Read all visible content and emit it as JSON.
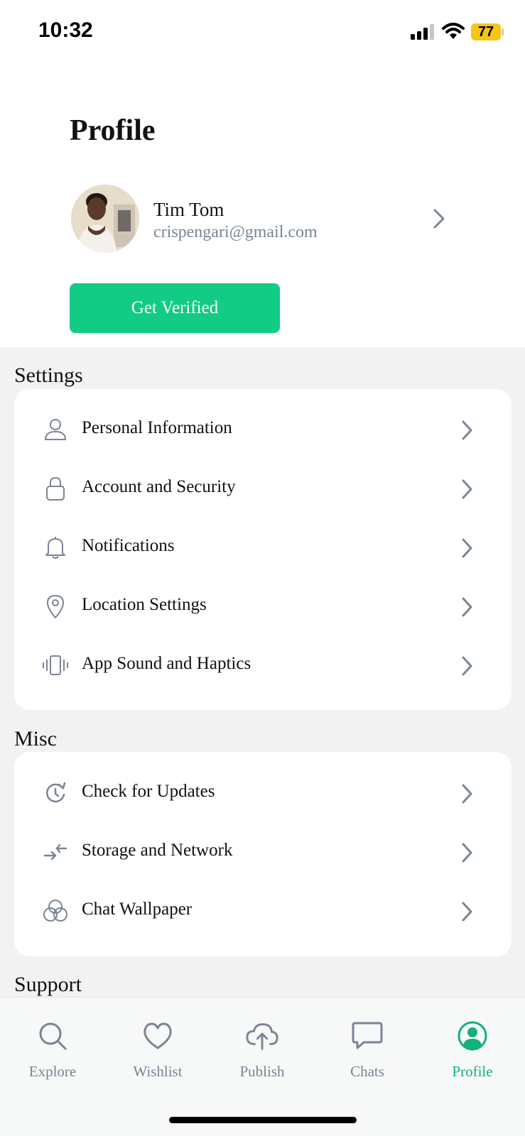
{
  "status_bar": {
    "time": "10:32",
    "battery": "77"
  },
  "header": {
    "title": "Profile"
  },
  "profile": {
    "name": "Tim Tom",
    "email": "crispengari@gmail.com"
  },
  "verify_button": {
    "label": "Get Verified"
  },
  "settings": {
    "title": "Settings",
    "items": [
      {
        "label": "Personal Information",
        "icon": "user-icon"
      },
      {
        "label": "Account and Security",
        "icon": "lock-icon"
      },
      {
        "label": "Notifications",
        "icon": "bell-icon"
      },
      {
        "label": "Location Settings",
        "icon": "location-pin-icon"
      },
      {
        "label": "App Sound and Haptics",
        "icon": "vibrate-icon"
      }
    ]
  },
  "misc": {
    "title": "Misc",
    "items": [
      {
        "label": "Check for Updates",
        "icon": "refresh-clock-icon"
      },
      {
        "label": "Storage and Network",
        "icon": "transfer-arrows-icon"
      },
      {
        "label": "Chat Wallpaper",
        "icon": "circles-icon"
      }
    ]
  },
  "support": {
    "title": "Support"
  },
  "tabbar": {
    "tabs": [
      {
        "label": "Explore",
        "icon": "search-icon"
      },
      {
        "label": "Wishlist",
        "icon": "heart-icon"
      },
      {
        "label": "Publish",
        "icon": "cloud-upload-icon"
      },
      {
        "label": "Chats",
        "icon": "chat-bubble-icon"
      },
      {
        "label": "Profile",
        "icon": "profile-icon",
        "active": true
      }
    ]
  },
  "colors": {
    "accent": "#12cc85",
    "icon_gray": "#7a8594",
    "background": "#f2f2f2"
  }
}
